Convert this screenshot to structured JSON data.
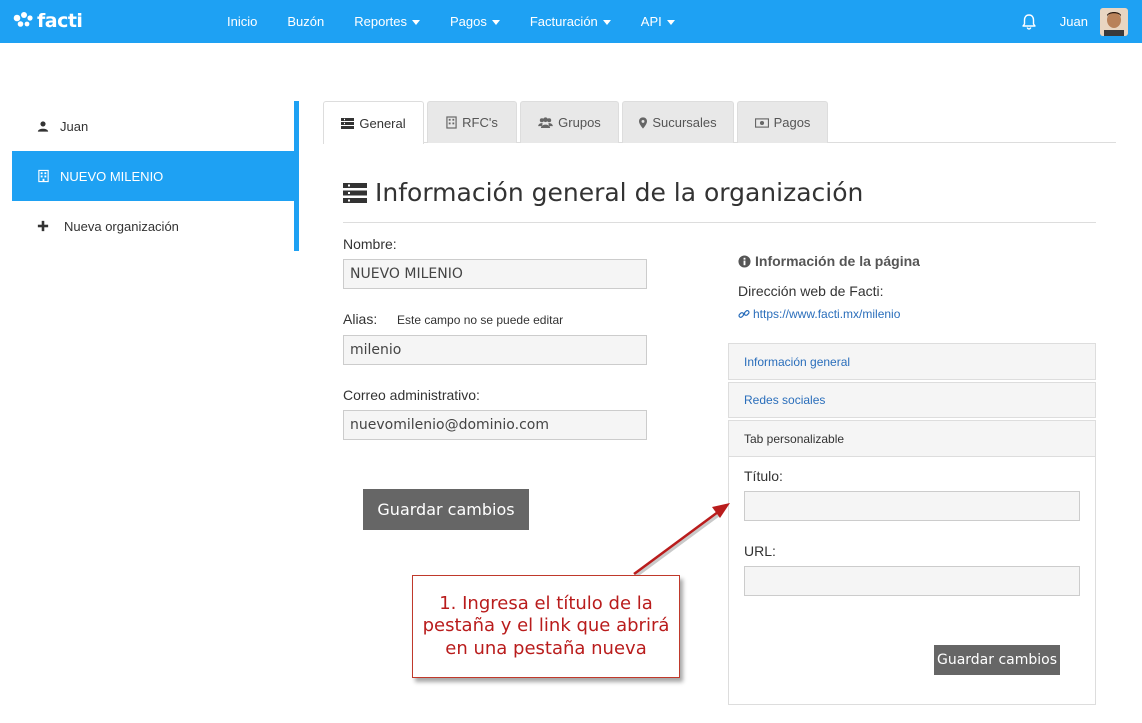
{
  "navbar": {
    "brand": "facti",
    "links": [
      {
        "label": "Inicio",
        "dropdown": false
      },
      {
        "label": "Buzón",
        "dropdown": false
      },
      {
        "label": "Reportes",
        "dropdown": true
      },
      {
        "label": "Pagos",
        "dropdown": true
      },
      {
        "label": "Facturación",
        "dropdown": true
      },
      {
        "label": "API",
        "dropdown": true
      }
    ],
    "user_name": "Juan",
    "bar_color": "#1ea1f3"
  },
  "sidebar": {
    "items": [
      {
        "label": "Juan",
        "icon": "user-icon"
      },
      {
        "label": "NUEVO MILENIO",
        "icon": "building-icon",
        "active": true
      },
      {
        "label": "Nueva organización",
        "icon": "plus-icon"
      }
    ]
  },
  "tabs": [
    {
      "label": "General",
      "icon": "list-icon",
      "active": true
    },
    {
      "label": "RFC's",
      "icon": "building-icon"
    },
    {
      "label": "Grupos",
      "icon": "users-icon"
    },
    {
      "label": "Sucursales",
      "icon": "map-marker-icon"
    },
    {
      "label": "Pagos",
      "icon": "money-icon"
    }
  ],
  "main": {
    "heading": "Información general de la organización",
    "form": {
      "nombre_label": "Nombre:",
      "nombre_value": "NUEVO MILENIO",
      "alias_label": "Alias:",
      "alias_note": "Este campo no se puede editar",
      "alias_value": "milenio",
      "correo_label": "Correo administrativo:",
      "correo_value": "nuevomilenio@dominio.com",
      "save_label": "Guardar cambios"
    }
  },
  "info": {
    "title": "Información de la página",
    "subtitle": "Dirección web de Facti:",
    "link": "https://www.facti.mx/milenio",
    "panels": [
      {
        "label": "Información general"
      },
      {
        "label": "Redes sociales"
      },
      {
        "label": "Tab personalizable",
        "expanded": true
      }
    ],
    "custom_tab": {
      "titulo_label": "Título:",
      "titulo_value": "",
      "url_label": "URL:",
      "url_value": "",
      "save_label": "Guardar cambios"
    }
  },
  "callout": {
    "text": "1. Ingresa el título de la pestaña y el link que abrirá en una pestaña nueva",
    "color": "#b91c1c"
  }
}
